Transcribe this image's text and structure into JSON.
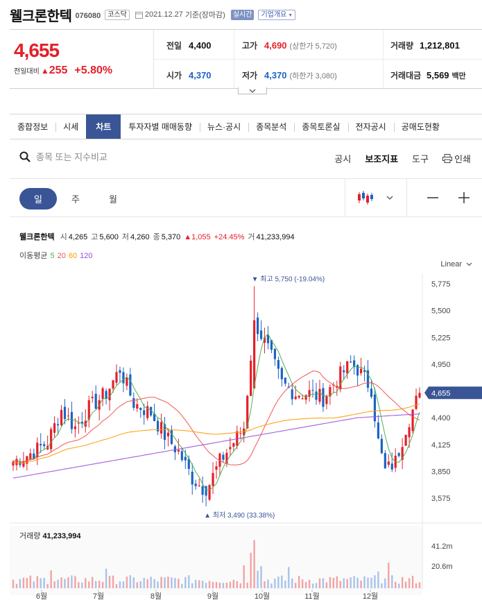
{
  "header": {
    "name": "웰크론한텍",
    "code": "076080",
    "market": "코스닥",
    "date": "2021.12.27",
    "basis": "기준(장마감)",
    "realtime": "실시간",
    "overview": "기업개요"
  },
  "quote": {
    "price": "4,655",
    "change_label": "전일대비",
    "change": "255",
    "change_rate": "+5.80%",
    "prev_label": "전일",
    "prev": "4,400",
    "high_label": "고가",
    "high": "4,690",
    "upper_label": "(상한가",
    "upper": "5,720)",
    "volume_label": "거래량",
    "volume": "1,212,801",
    "open_label": "시가",
    "open": "4,370",
    "low_label": "저가",
    "low": "4,370",
    "lower_label": "(하한가",
    "lower": "3,080)",
    "amount_label": "거래대금",
    "amount": "5,569",
    "amount_unit": "백만"
  },
  "tabs": [
    "종합정보",
    "시세",
    "차트",
    "투자자별 매매동향",
    "뉴스·공시",
    "종목분석",
    "종목토론실",
    "전자공시",
    "공매도현황"
  ],
  "active_tab": 2,
  "toolbar": {
    "search_placeholder": "종목 또는 지수비교",
    "disclosure": "공시",
    "indicators": "보조지표",
    "tools": "도구",
    "print": "인쇄"
  },
  "periods": [
    "일",
    "주",
    "월"
  ],
  "chart_info": {
    "name": "웰크론한텍",
    "open_l": "시",
    "open": "4,265",
    "high_l": "고",
    "high": "5,600",
    "low_l": "저",
    "low": "4,260",
    "close_l": "종",
    "close": "5,370",
    "chg": "1,055",
    "rate": "+24.45%",
    "vol_l": "거",
    "vol": "41,233,994",
    "ma_label": "이동평균",
    "ma": [
      "5",
      "20",
      "60",
      "120"
    ],
    "scale": "Linear",
    "max_label": "최고 5,750 (-19.04%)",
    "min_label": "최저 3,490 (33.38%)",
    "current_tag": "4,655",
    "volume_label": "거래량",
    "volume_value": "41,233,994"
  },
  "colors": {
    "up": "#e4202a",
    "down": "#1d63c4",
    "ma5": "#4caf50",
    "ma20": "#ef5350",
    "ma60": "#ff9800",
    "ma120": "#9c4dd8",
    "accent": "#3a5595"
  },
  "chart_data": {
    "type": "candlestick",
    "scale": "linear",
    "ylim": [
      3490,
      5800
    ],
    "y_ticks": [
      "5,775",
      "5,500",
      "5,225",
      "4,950",
      "4,675",
      "4,400",
      "4,125",
      "3,850",
      "3,575"
    ],
    "x_ticks": [
      "6월",
      "7월",
      "8월",
      "9월",
      "10월",
      "11월",
      "12월"
    ],
    "volume_ticks": [
      "41.2m",
      "20.6m"
    ],
    "max": 5750,
    "min": 3490,
    "last": 4655,
    "waypoints": [
      [
        0,
        3950
      ],
      [
        6,
        4050
      ],
      [
        10,
        4150
      ],
      [
        14,
        4480
      ],
      [
        18,
        4300
      ],
      [
        22,
        4500
      ],
      [
        27,
        4650
      ],
      [
        31,
        4900
      ],
      [
        35,
        4550
      ],
      [
        40,
        4450
      ],
      [
        44,
        4220
      ],
      [
        48,
        4050
      ],
      [
        52,
        3780
      ],
      [
        56,
        3650
      ],
      [
        60,
        3950
      ],
      [
        64,
        4150
      ],
      [
        67,
        4300
      ],
      [
        70,
        5400
      ],
      [
        74,
        5100
      ],
      [
        78,
        4750
      ],
      [
        82,
        4650
      ],
      [
        86,
        4650
      ],
      [
        90,
        4600
      ],
      [
        94,
        4800
      ],
      [
        98,
        4950
      ],
      [
        100,
        4900
      ],
      [
        104,
        4700
      ],
      [
        106,
        4150
      ],
      [
        108,
        3850
      ],
      [
        111,
        3950
      ],
      [
        114,
        4300
      ],
      [
        118,
        4655
      ]
    ]
  }
}
